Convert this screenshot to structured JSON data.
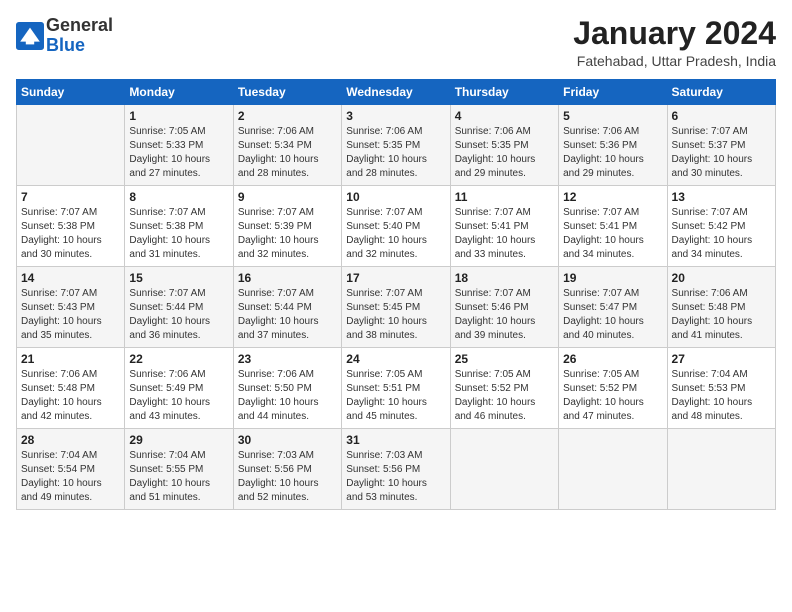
{
  "header": {
    "logo_line1": "General",
    "logo_line2": "Blue",
    "month_title": "January 2024",
    "location": "Fatehabad, Uttar Pradesh, India"
  },
  "weekdays": [
    "Sunday",
    "Monday",
    "Tuesday",
    "Wednesday",
    "Thursday",
    "Friday",
    "Saturday"
  ],
  "weeks": [
    [
      {
        "day": "",
        "info": ""
      },
      {
        "day": "1",
        "info": "Sunrise: 7:05 AM\nSunset: 5:33 PM\nDaylight: 10 hours\nand 27 minutes."
      },
      {
        "day": "2",
        "info": "Sunrise: 7:06 AM\nSunset: 5:34 PM\nDaylight: 10 hours\nand 28 minutes."
      },
      {
        "day": "3",
        "info": "Sunrise: 7:06 AM\nSunset: 5:35 PM\nDaylight: 10 hours\nand 28 minutes."
      },
      {
        "day": "4",
        "info": "Sunrise: 7:06 AM\nSunset: 5:35 PM\nDaylight: 10 hours\nand 29 minutes."
      },
      {
        "day": "5",
        "info": "Sunrise: 7:06 AM\nSunset: 5:36 PM\nDaylight: 10 hours\nand 29 minutes."
      },
      {
        "day": "6",
        "info": "Sunrise: 7:07 AM\nSunset: 5:37 PM\nDaylight: 10 hours\nand 30 minutes."
      }
    ],
    [
      {
        "day": "7",
        "info": "Sunrise: 7:07 AM\nSunset: 5:38 PM\nDaylight: 10 hours\nand 30 minutes."
      },
      {
        "day": "8",
        "info": "Sunrise: 7:07 AM\nSunset: 5:38 PM\nDaylight: 10 hours\nand 31 minutes."
      },
      {
        "day": "9",
        "info": "Sunrise: 7:07 AM\nSunset: 5:39 PM\nDaylight: 10 hours\nand 32 minutes."
      },
      {
        "day": "10",
        "info": "Sunrise: 7:07 AM\nSunset: 5:40 PM\nDaylight: 10 hours\nand 32 minutes."
      },
      {
        "day": "11",
        "info": "Sunrise: 7:07 AM\nSunset: 5:41 PM\nDaylight: 10 hours\nand 33 minutes."
      },
      {
        "day": "12",
        "info": "Sunrise: 7:07 AM\nSunset: 5:41 PM\nDaylight: 10 hours\nand 34 minutes."
      },
      {
        "day": "13",
        "info": "Sunrise: 7:07 AM\nSunset: 5:42 PM\nDaylight: 10 hours\nand 34 minutes."
      }
    ],
    [
      {
        "day": "14",
        "info": "Sunrise: 7:07 AM\nSunset: 5:43 PM\nDaylight: 10 hours\nand 35 minutes."
      },
      {
        "day": "15",
        "info": "Sunrise: 7:07 AM\nSunset: 5:44 PM\nDaylight: 10 hours\nand 36 minutes."
      },
      {
        "day": "16",
        "info": "Sunrise: 7:07 AM\nSunset: 5:44 PM\nDaylight: 10 hours\nand 37 minutes."
      },
      {
        "day": "17",
        "info": "Sunrise: 7:07 AM\nSunset: 5:45 PM\nDaylight: 10 hours\nand 38 minutes."
      },
      {
        "day": "18",
        "info": "Sunrise: 7:07 AM\nSunset: 5:46 PM\nDaylight: 10 hours\nand 39 minutes."
      },
      {
        "day": "19",
        "info": "Sunrise: 7:07 AM\nSunset: 5:47 PM\nDaylight: 10 hours\nand 40 minutes."
      },
      {
        "day": "20",
        "info": "Sunrise: 7:06 AM\nSunset: 5:48 PM\nDaylight: 10 hours\nand 41 minutes."
      }
    ],
    [
      {
        "day": "21",
        "info": "Sunrise: 7:06 AM\nSunset: 5:48 PM\nDaylight: 10 hours\nand 42 minutes."
      },
      {
        "day": "22",
        "info": "Sunrise: 7:06 AM\nSunset: 5:49 PM\nDaylight: 10 hours\nand 43 minutes."
      },
      {
        "day": "23",
        "info": "Sunrise: 7:06 AM\nSunset: 5:50 PM\nDaylight: 10 hours\nand 44 minutes."
      },
      {
        "day": "24",
        "info": "Sunrise: 7:05 AM\nSunset: 5:51 PM\nDaylight: 10 hours\nand 45 minutes."
      },
      {
        "day": "25",
        "info": "Sunrise: 7:05 AM\nSunset: 5:52 PM\nDaylight: 10 hours\nand 46 minutes."
      },
      {
        "day": "26",
        "info": "Sunrise: 7:05 AM\nSunset: 5:52 PM\nDaylight: 10 hours\nand 47 minutes."
      },
      {
        "day": "27",
        "info": "Sunrise: 7:04 AM\nSunset: 5:53 PM\nDaylight: 10 hours\nand 48 minutes."
      }
    ],
    [
      {
        "day": "28",
        "info": "Sunrise: 7:04 AM\nSunset: 5:54 PM\nDaylight: 10 hours\nand 49 minutes."
      },
      {
        "day": "29",
        "info": "Sunrise: 7:04 AM\nSunset: 5:55 PM\nDaylight: 10 hours\nand 51 minutes."
      },
      {
        "day": "30",
        "info": "Sunrise: 7:03 AM\nSunset: 5:56 PM\nDaylight: 10 hours\nand 52 minutes."
      },
      {
        "day": "31",
        "info": "Sunrise: 7:03 AM\nSunset: 5:56 PM\nDaylight: 10 hours\nand 53 minutes."
      },
      {
        "day": "",
        "info": ""
      },
      {
        "day": "",
        "info": ""
      },
      {
        "day": "",
        "info": ""
      }
    ]
  ]
}
